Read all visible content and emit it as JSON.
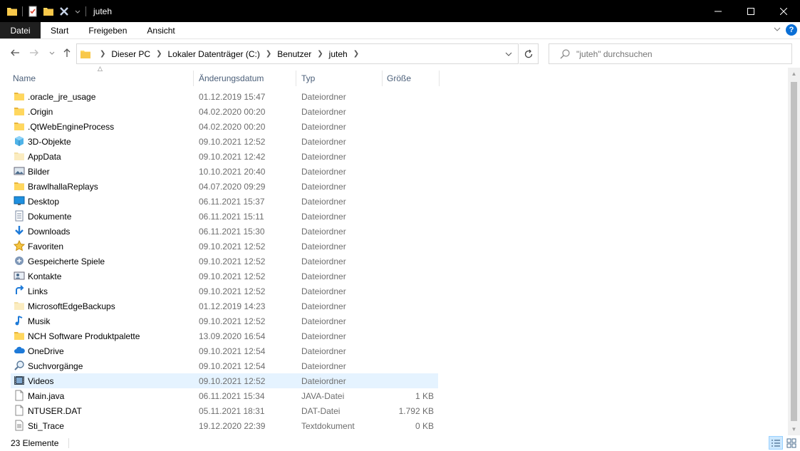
{
  "window": {
    "title": "juteh"
  },
  "ribbon": {
    "tabs": [
      "Datei",
      "Start",
      "Freigeben",
      "Ansicht"
    ],
    "help_label": "?"
  },
  "address": {
    "crumbs": [
      "Dieser PC",
      "Lokaler Datenträger (C:)",
      "Benutzer",
      "juteh"
    ]
  },
  "search": {
    "placeholder": "\"juteh\" durchsuchen"
  },
  "columns": {
    "name": "Name",
    "date": "Änderungsdatum",
    "type": "Typ",
    "size": "Größe"
  },
  "files": [
    {
      "name": ".oracle_jre_usage",
      "date": "01.12.2019 15:47",
      "type": "Dateiordner",
      "size": "",
      "icon": "folder-icon"
    },
    {
      "name": ".Origin",
      "date": "04.02.2020 00:20",
      "type": "Dateiordner",
      "size": "",
      "icon": "folder-icon"
    },
    {
      "name": ".QtWebEngineProcess",
      "date": "04.02.2020 00:20",
      "type": "Dateiordner",
      "size": "",
      "icon": "folder-icon"
    },
    {
      "name": "3D-Objekte",
      "date": "09.10.2021 12:52",
      "type": "Dateiordner",
      "size": "",
      "icon": "3d-objects-icon"
    },
    {
      "name": "AppData",
      "date": "09.10.2021 12:42",
      "type": "Dateiordner",
      "size": "",
      "icon": "hidden-folder-icon"
    },
    {
      "name": "Bilder",
      "date": "10.10.2021 20:40",
      "type": "Dateiordner",
      "size": "",
      "icon": "pictures-icon"
    },
    {
      "name": "BrawlhallaReplays",
      "date": "04.07.2020 09:29",
      "type": "Dateiordner",
      "size": "",
      "icon": "folder-icon"
    },
    {
      "name": "Desktop",
      "date": "06.11.2021 15:37",
      "type": "Dateiordner",
      "size": "",
      "icon": "desktop-icon"
    },
    {
      "name": "Dokumente",
      "date": "06.11.2021 15:11",
      "type": "Dateiordner",
      "size": "",
      "icon": "documents-icon"
    },
    {
      "name": "Downloads",
      "date": "06.11.2021 15:30",
      "type": "Dateiordner",
      "size": "",
      "icon": "downloads-icon"
    },
    {
      "name": "Favoriten",
      "date": "09.10.2021 12:52",
      "type": "Dateiordner",
      "size": "",
      "icon": "favorites-star-icon"
    },
    {
      "name": "Gespeicherte Spiele",
      "date": "09.10.2021 12:52",
      "type": "Dateiordner",
      "size": "",
      "icon": "saved-games-icon"
    },
    {
      "name": "Kontakte",
      "date": "09.10.2021 12:52",
      "type": "Dateiordner",
      "size": "",
      "icon": "contacts-icon"
    },
    {
      "name": "Links",
      "date": "09.10.2021 12:52",
      "type": "Dateiordner",
      "size": "",
      "icon": "links-icon"
    },
    {
      "name": "MicrosoftEdgeBackups",
      "date": "01.12.2019 14:23",
      "type": "Dateiordner",
      "size": "",
      "icon": "hidden-folder-icon"
    },
    {
      "name": "Musik",
      "date": "09.10.2021 12:52",
      "type": "Dateiordner",
      "size": "",
      "icon": "music-icon"
    },
    {
      "name": "NCH Software Produktpalette",
      "date": "13.09.2020 16:54",
      "type": "Dateiordner",
      "size": "",
      "icon": "folder-icon"
    },
    {
      "name": "OneDrive",
      "date": "09.10.2021 12:54",
      "type": "Dateiordner",
      "size": "",
      "icon": "onedrive-cloud-icon"
    },
    {
      "name": "Suchvorgänge",
      "date": "09.10.2021 12:54",
      "type": "Dateiordner",
      "size": "",
      "icon": "searches-icon"
    },
    {
      "name": "Videos",
      "date": "09.10.2021 12:52",
      "type": "Dateiordner",
      "size": "",
      "icon": "videos-icon",
      "selected": true
    },
    {
      "name": "Main.java",
      "date": "06.11.2021 15:34",
      "type": "JAVA-Datei",
      "size": "1 KB",
      "icon": "file-icon"
    },
    {
      "name": "NTUSER.DAT",
      "date": "05.11.2021 18:31",
      "type": "DAT-Datei",
      "size": "1.792 KB",
      "icon": "file-icon"
    },
    {
      "name": "Sti_Trace",
      "date": "19.12.2020 22:39",
      "type": "Textdokument",
      "size": "0 KB",
      "icon": "text-document-icon"
    }
  ],
  "status": {
    "item_count": "23 Elemente"
  },
  "colors": {
    "titlebar_bg": "#000000",
    "selection_bg": "#e5f3ff",
    "header_text": "#4c607a",
    "accent_blue": "#0a6fd6",
    "folder_yellow": "#ffd75e"
  }
}
